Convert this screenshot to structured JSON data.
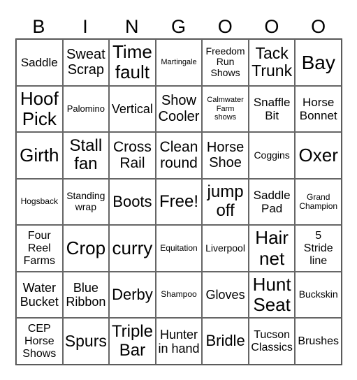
{
  "header": [
    "B",
    "I",
    "N",
    "G",
    "O",
    "O",
    "O"
  ],
  "cells": [
    [
      "Saddle",
      "Sweat\nScrap",
      "Time\nfault",
      "Martingale",
      "Freedom\nRun\nShows",
      "Tack\nTrunk",
      "Bay"
    ],
    [
      "Hoof\nPick",
      "Palomino",
      "Vertical",
      "Show\nCooler",
      "Calmwater\nFarm\nshows",
      "Snaffle\nBit",
      "Horse\nBonnet"
    ],
    [
      "Girth",
      "Stall\nfan",
      "Cross\nRail",
      "Clean\nround",
      "Horse\nShoe",
      "Coggins",
      "Oxer"
    ],
    [
      "Hogsback",
      "Standing\nwrap",
      "Boots",
      "Free!",
      "jump\noff",
      "Saddle\nPad",
      "Grand\nChampion"
    ],
    [
      "Four\nReel\nFarms",
      "Crop",
      "curry",
      "Equitation",
      "Liverpool",
      "Hair\nnet",
      "5\nStride\nline"
    ],
    [
      "Water\nBucket",
      "Blue\nRibbon",
      "Derby",
      "Shampoo",
      "Gloves",
      "Hunt\nSeat",
      "Buckskin"
    ],
    [
      "CEP\nHorse\nShows",
      "Spurs",
      "Triple\nBar",
      "Hunter\nin hand",
      "Bridle",
      "Tucson\nClassics",
      "Brushes"
    ]
  ]
}
